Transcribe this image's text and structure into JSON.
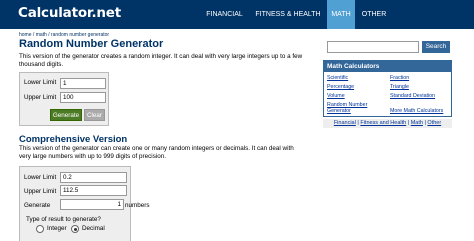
{
  "header": {
    "logo": "Calculator.net",
    "nav": [
      "FINANCIAL",
      "FITNESS & HEALTH",
      "MATH",
      "OTHER"
    ],
    "active": "MATH"
  },
  "breadcrumb": {
    "home": "home",
    "sep1": " / ",
    "math": "math",
    "sep2": " / ",
    "current": "random number generator"
  },
  "main": {
    "title": "Random Number Generator",
    "desc": "This version of the generator creates a random integer. It can deal with very large integers up to a few thousand digits.",
    "simple": {
      "lower_label": "Lower Limit",
      "lower_value": "1",
      "upper_label": "Upper Limit",
      "upper_value": "100",
      "generate": "Generate",
      "clear": "Clear"
    },
    "comprehensive": {
      "title": "Comprehensive Version",
      "desc": "This version of the generator can create one or many random integers or decimals. It can deal with very large numbers with up to 999 digits of precision.",
      "lower_label": "Lower Limit",
      "lower_value": "0.2",
      "upper_label": "Upper Limit",
      "upper_value": "112.5",
      "generate_label": "Generate",
      "generate_count": "1",
      "numbers_label": "numbers",
      "type_question": "Type of result to generate?",
      "opt_integer": "Integer",
      "opt_decimal": "Decimal"
    }
  },
  "sidebar": {
    "search_button": "Search",
    "box_title": "Math Calculators",
    "links_left": [
      "Scientific",
      "Percentage",
      "Volume",
      "Random Number",
      "Generator"
    ],
    "links_right": [
      "Fraction",
      "Triangle",
      "Standard Deviation",
      "More Math Calculators"
    ],
    "footer": [
      "Financial",
      "Fitness and Health",
      "Math",
      "Other"
    ],
    "footer_sep": " | "
  },
  "colors": {
    "topbar": "#003366",
    "active_tab": "#51a0d3",
    "generate_button": "#4c7b25",
    "sidebar_accent": "#336699"
  }
}
